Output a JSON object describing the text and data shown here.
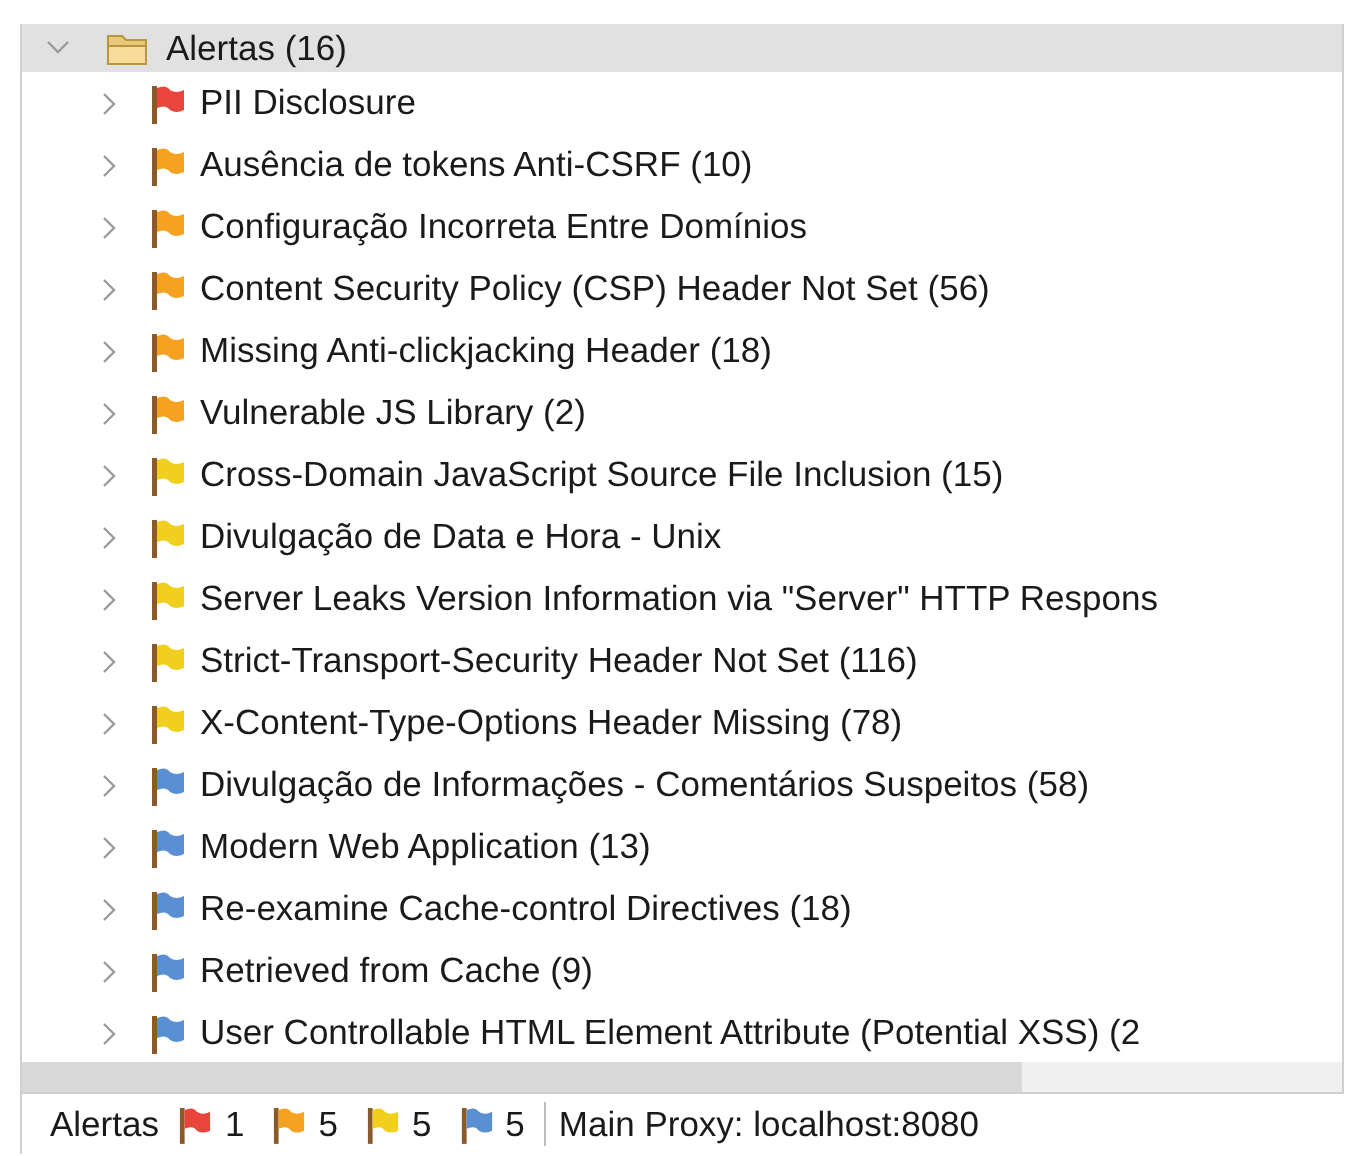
{
  "tree": {
    "label": "Alertas (16)",
    "expanded": true,
    "children": [
      {
        "label": "PII Disclosure",
        "color": "#e8463c",
        "expanded": false
      },
      {
        "label": "Ausência de tokens Anti-CSRF (10)",
        "color": "#f5a223",
        "expanded": false
      },
      {
        "label": "Configuração Incorreta Entre Domínios",
        "color": "#f5a223",
        "expanded": false
      },
      {
        "label": "Content Security Policy (CSP) Header Not Set (56)",
        "color": "#f5a223",
        "expanded": false
      },
      {
        "label": "Missing Anti-clickjacking Header (18)",
        "color": "#f5a223",
        "expanded": false
      },
      {
        "label": "Vulnerable JS Library (2)",
        "color": "#f5a223",
        "expanded": false
      },
      {
        "label": "Cross-Domain JavaScript Source File Inclusion (15)",
        "color": "#f0cf1e",
        "expanded": false
      },
      {
        "label": "Divulgação de Data e Hora - Unix",
        "color": "#f0cf1e",
        "expanded": false
      },
      {
        "label": "Server Leaks Version Information via \"Server\" HTTP Respons",
        "color": "#f0cf1e",
        "expanded": false
      },
      {
        "label": "Strict-Transport-Security Header Not Set (116)",
        "color": "#f0cf1e",
        "expanded": false
      },
      {
        "label": "X-Content-Type-Options Header Missing (78)",
        "color": "#f0cf1e",
        "expanded": false
      },
      {
        "label": "Divulgação de Informações - Comentários Suspeitos (58)",
        "color": "#5b8fd4",
        "expanded": false
      },
      {
        "label": "Modern Web Application (13)",
        "color": "#5b8fd4",
        "expanded": false
      },
      {
        "label": "Re-examine Cache-control Directives (18)",
        "color": "#5b8fd4",
        "expanded": false
      },
      {
        "label": "Retrieved from Cache (9)",
        "color": "#5b8fd4",
        "expanded": false
      },
      {
        "label": "User Controllable HTML Element Attribute (Potential XSS) (2",
        "color": "#5b8fd4",
        "expanded": false
      }
    ]
  },
  "status_bar": {
    "label": "Alertas",
    "counts": [
      {
        "count": "1",
        "color": "#e8463c"
      },
      {
        "count": "5",
        "color": "#f5a223"
      },
      {
        "count": "5",
        "color": "#f0cf1e"
      },
      {
        "count": "5",
        "color": "#5b8fd4"
      }
    ],
    "proxy": "Main Proxy: localhost:8080"
  }
}
